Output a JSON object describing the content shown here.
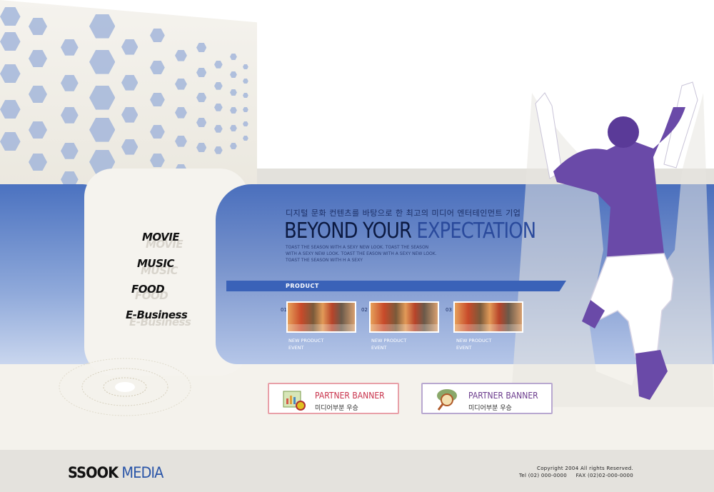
{
  "nav": {
    "items": [
      {
        "label": "MOVIE",
        "echo": "MOVIE"
      },
      {
        "label": "MUSIC",
        "echo": "MUSIC"
      },
      {
        "label": "FOOD",
        "echo": "FOOD"
      },
      {
        "label": "E-Business",
        "echo": "E-Business"
      }
    ]
  },
  "hero": {
    "kicker": "디지털 문화 컨텐츠를 바탕으로 한 최고의 미디어 엔터테인먼트 기업",
    "headline_dark": "BEYOND  YOUR",
    "headline_blue": " EXPECTATION",
    "desc_lines": [
      "TOAST THE SEASON WITH A SEXY NEW LOOK. TOAST THE SEASON",
      "WITH A SEXY NEW LOOK. TOAST THE EASON WITH A SEXY NEW LOOK.",
      "TOAST THE SEASON WITH H A SEXY"
    ]
  },
  "products": {
    "label": "PRODUCT",
    "items": [
      {
        "num": "01",
        "line1": "NEW PRODUCT",
        "line2": "EVENT"
      },
      {
        "num": "02",
        "line1": "NEW PRODUCT",
        "line2": "EVENT"
      },
      {
        "num": "03",
        "line1": "NEW PRODUCT",
        "line2": "EVENT"
      }
    ]
  },
  "banners": [
    {
      "title": "PARTNER BANNER",
      "sub": "미디어부분 우승",
      "color": "#c8314a",
      "icon": "chart-document-icon"
    },
    {
      "title": "PARTNER BANNER",
      "sub": "미디어부분 우승",
      "color": "#6a3a8c",
      "icon": "magnifier-globe-icon"
    }
  ],
  "footer": {
    "logo_a": "SSOOK",
    "logo_b": " MEDIA",
    "copyright": "Copyright 2004 All rights Reserved.",
    "contact": "Tel (02) 000-0000     FAX (02)02-000-0000"
  }
}
